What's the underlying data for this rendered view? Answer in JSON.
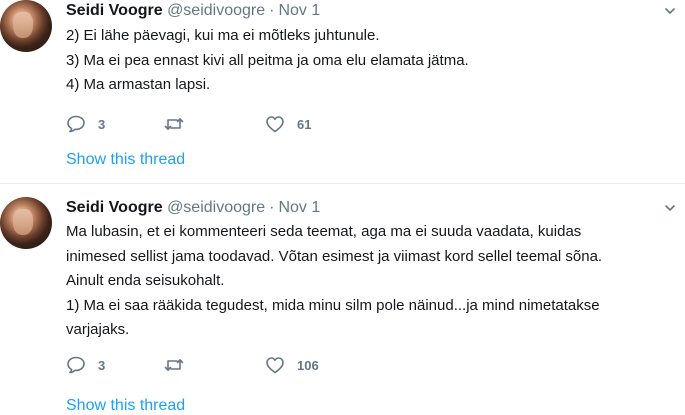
{
  "tweets": [
    {
      "name": "Seidi Voogre",
      "handle": "@seidivoogre",
      "separator": "·",
      "date": "Nov 1",
      "lines": [
        "2) Ei lähe päevagi, kui ma ei mõtleks juhtunule.",
        "3) Ma ei pea ennast kivi all peitma ja oma elu elamata jätma.",
        "4) Ma armastan lapsi."
      ],
      "reply_count": "3",
      "retweet_count": "",
      "like_count": "61",
      "thread_link": "Show this thread"
    },
    {
      "name": "Seidi Voogre",
      "handle": "@seidivoogre",
      "separator": "·",
      "date": "Nov 1",
      "lines": [
        "Ma lubasin, et ei kommenteeri seda teemat, aga ma ei suuda vaadata, kuidas",
        "inimesed sellist jama toodavad. Võtan esimest ja viimast kord sellel teemal sõna.",
        "Ainult enda seisukohalt.",
        "1) Ma ei saa rääkida tegudest, mida minu silm pole näinud...ja mind nimetatakse",
        "varjajaks."
      ],
      "reply_count": "3",
      "retweet_count": "",
      "like_count": "106",
      "thread_link": "Show this thread"
    }
  ],
  "icons": {
    "reply": "reply-icon",
    "retweet": "retweet-icon",
    "like": "heart-icon",
    "caret": "chevron-down-icon"
  },
  "colors": {
    "text": "#14171a",
    "muted": "#657786",
    "link": "#1da1f2",
    "divider": "#e6ecf0"
  }
}
